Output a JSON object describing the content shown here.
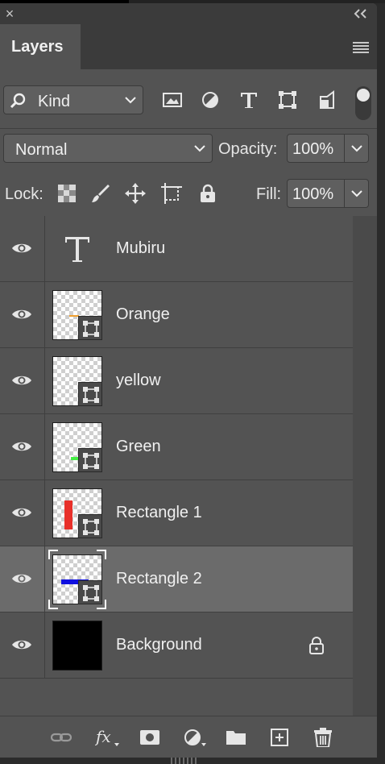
{
  "panel": {
    "close_glyph": "×",
    "tab_label": "Layers",
    "filter": {
      "kind_label": "Kind",
      "icons": [
        "image-filter-icon",
        "adjustment-filter-icon",
        "type-filter-icon",
        "shape-filter-icon",
        "smart-object-filter-icon"
      ]
    },
    "blend_mode": "Normal",
    "opacity_label": "Opacity:",
    "opacity_value": "100%",
    "lock_label": "Lock:",
    "fill_label": "Fill:",
    "fill_value": "100%"
  },
  "layers": [
    {
      "name": "Mubiru",
      "type": "text",
      "visible": true,
      "selected": false
    },
    {
      "name": "Orange",
      "type": "shape",
      "color": "#f0a030",
      "visible": true,
      "selected": false
    },
    {
      "name": "yellow",
      "type": "shape",
      "color": "#e8d23a",
      "visible": true,
      "selected": false
    },
    {
      "name": "Green",
      "type": "shape",
      "color": "#44ee44",
      "visible": true,
      "selected": false
    },
    {
      "name": "Rectangle 1",
      "type": "shape",
      "color": "#e8302a",
      "visible": true,
      "selected": false
    },
    {
      "name": "Rectangle 2",
      "type": "shape",
      "color": "#1010e0",
      "visible": true,
      "selected": true
    },
    {
      "name": "Background",
      "type": "background",
      "color": "#000000",
      "visible": true,
      "locked": true,
      "selected": false
    }
  ],
  "colors": {
    "panel_bg": "#535353",
    "selected_row": "#6b6b6b",
    "titlebar": "#3b3b3b"
  }
}
